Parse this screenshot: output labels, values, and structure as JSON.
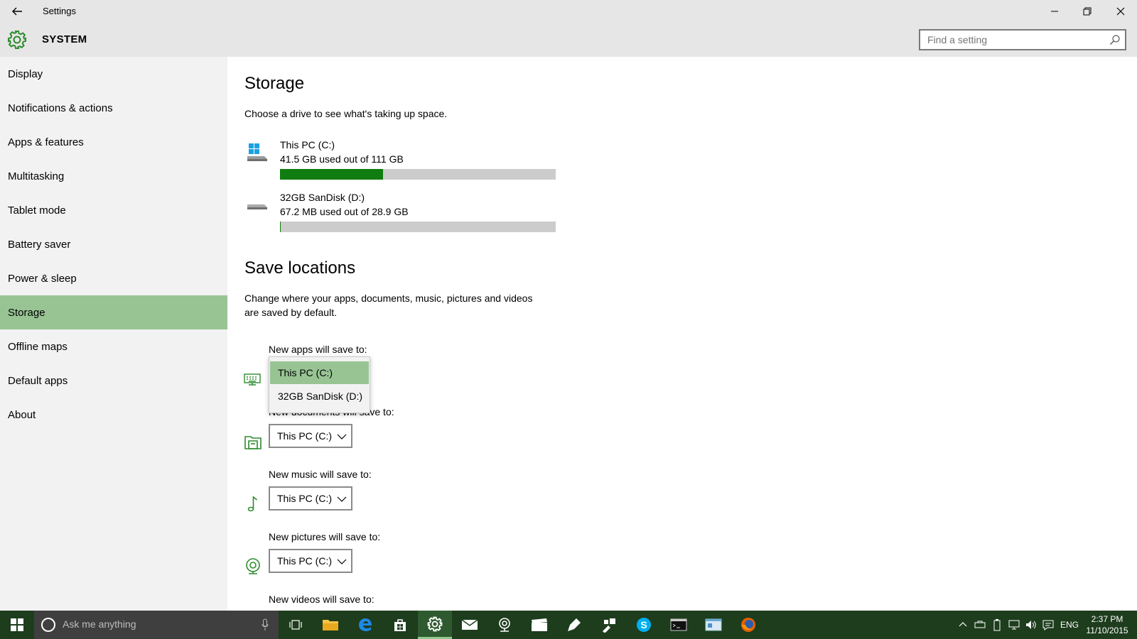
{
  "window": {
    "title": "Settings",
    "back_icon": "back-arrow-icon",
    "minimize_glyph": "—",
    "restore_glyph": "❐",
    "close_glyph": "✕"
  },
  "header": {
    "section_title": "SYSTEM",
    "search_placeholder": "Find a setting"
  },
  "sidebar": {
    "items": [
      {
        "label": "Display"
      },
      {
        "label": "Notifications & actions"
      },
      {
        "label": "Apps & features"
      },
      {
        "label": "Multitasking"
      },
      {
        "label": "Tablet mode"
      },
      {
        "label": "Battery saver"
      },
      {
        "label": "Power & sleep"
      },
      {
        "label": "Storage",
        "selected": true
      },
      {
        "label": "Offline maps"
      },
      {
        "label": "Default apps"
      },
      {
        "label": "About"
      }
    ]
  },
  "storage": {
    "title": "Storage",
    "subtitle": "Choose a drive to see what's taking up space.",
    "drives": [
      {
        "name": "This PC (C:)",
        "usage": "41.5 GB used out of 111 GB",
        "used_fraction": 0.374,
        "icon": "windows-drive-icon"
      },
      {
        "name": "32GB SanDisk (D:)",
        "usage": "67.2 MB used out of 28.9 GB",
        "used_fraction": 0.002,
        "icon": "removable-drive-icon"
      }
    ]
  },
  "save_locations": {
    "title": "Save locations",
    "description_line1": "Change where your apps, documents, music, pictures and videos",
    "description_line2": "are saved by default.",
    "items": [
      {
        "label": "New apps will save to:",
        "value": "This PC (C:)",
        "icon": "apps-keyboard-icon"
      },
      {
        "label": "New documents will save to:",
        "value": "This PC (C:)",
        "icon": "documents-folder-icon"
      },
      {
        "label": "New music will save to:",
        "value": "This PC (C:)",
        "icon": "music-note-icon"
      },
      {
        "label": "New pictures will save to:",
        "value": "This PC (C:)",
        "icon": "pictures-camera-icon"
      },
      {
        "label": "New videos will save to:"
      }
    ],
    "open_dropdown": {
      "options": [
        "This PC (C:)",
        "32GB SanDisk (D:)"
      ],
      "selected": "This PC (C:)"
    }
  },
  "taskbar": {
    "search_placeholder": "Ask me anything",
    "language": "ENG",
    "time": "2:37 PM",
    "date": "11/10/2015",
    "apps": [
      "task-view-icon",
      "file-explorer-icon",
      "edge-icon",
      "store-icon",
      "settings-icon",
      "mail-icon",
      "camera-icon",
      "films-icon",
      "paint-icon",
      "tools-icon",
      "skype-icon",
      "cmd-icon",
      "explorer-window-icon",
      "firefox-icon"
    ]
  },
  "colors": {
    "accent": "#98c494",
    "progress_fill": "#0f7d0f",
    "taskbar": "#1d3d1d",
    "sidebar_bg": "#f2f2f2",
    "titlebar_bg": "#e6e6e6"
  }
}
